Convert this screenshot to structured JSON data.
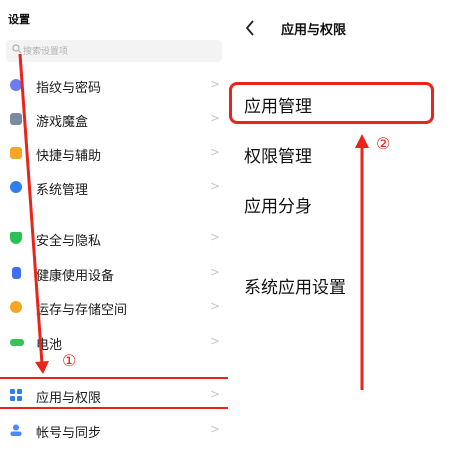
{
  "left": {
    "title": "设置",
    "search_placeholder": "搜索设置项",
    "items": [
      {
        "label": "指纹与密码",
        "color": "#6c7cf0",
        "icon": "fingerprint-icon",
        "chevron": ">"
      },
      {
        "label": "游戏魔盒",
        "color": "#7a8aa0",
        "icon": "game-box-icon",
        "chevron": ">"
      },
      {
        "label": "快捷与辅助",
        "color": "#f5a623",
        "icon": "shortcut-icon",
        "chevron": ">"
      },
      {
        "label": "系统管理",
        "color": "#2f7ef0",
        "icon": "system-icon",
        "chevron": ">"
      },
      {
        "label": "安全与隐私",
        "color": "#2fbf5a",
        "icon": "shield-icon",
        "chevron": ">"
      },
      {
        "label": "健康使用设备",
        "color": "#3d6ff0",
        "icon": "health-icon",
        "chevron": ">"
      },
      {
        "label": "运存与存储空间",
        "color": "#f5a623",
        "icon": "storage-icon",
        "chevron": ">"
      },
      {
        "label": "电池",
        "color": "#38c25a",
        "icon": "battery-icon",
        "chevron": ">"
      },
      {
        "label": "应用与权限",
        "color": "#2f7ef0",
        "icon": "apps-icon",
        "chevron": ">"
      },
      {
        "label": "帐号与同步",
        "color": "#4a8af5",
        "icon": "account-icon",
        "chevron": ">"
      }
    ]
  },
  "right": {
    "title": "应用与权限",
    "items": [
      {
        "label": "应用管理"
      },
      {
        "label": "权限管理"
      },
      {
        "label": "应用分身"
      },
      {
        "label": "系统应用设置"
      }
    ]
  },
  "annotations": {
    "step1": "①",
    "step2": "②",
    "color": "#e8241b"
  }
}
